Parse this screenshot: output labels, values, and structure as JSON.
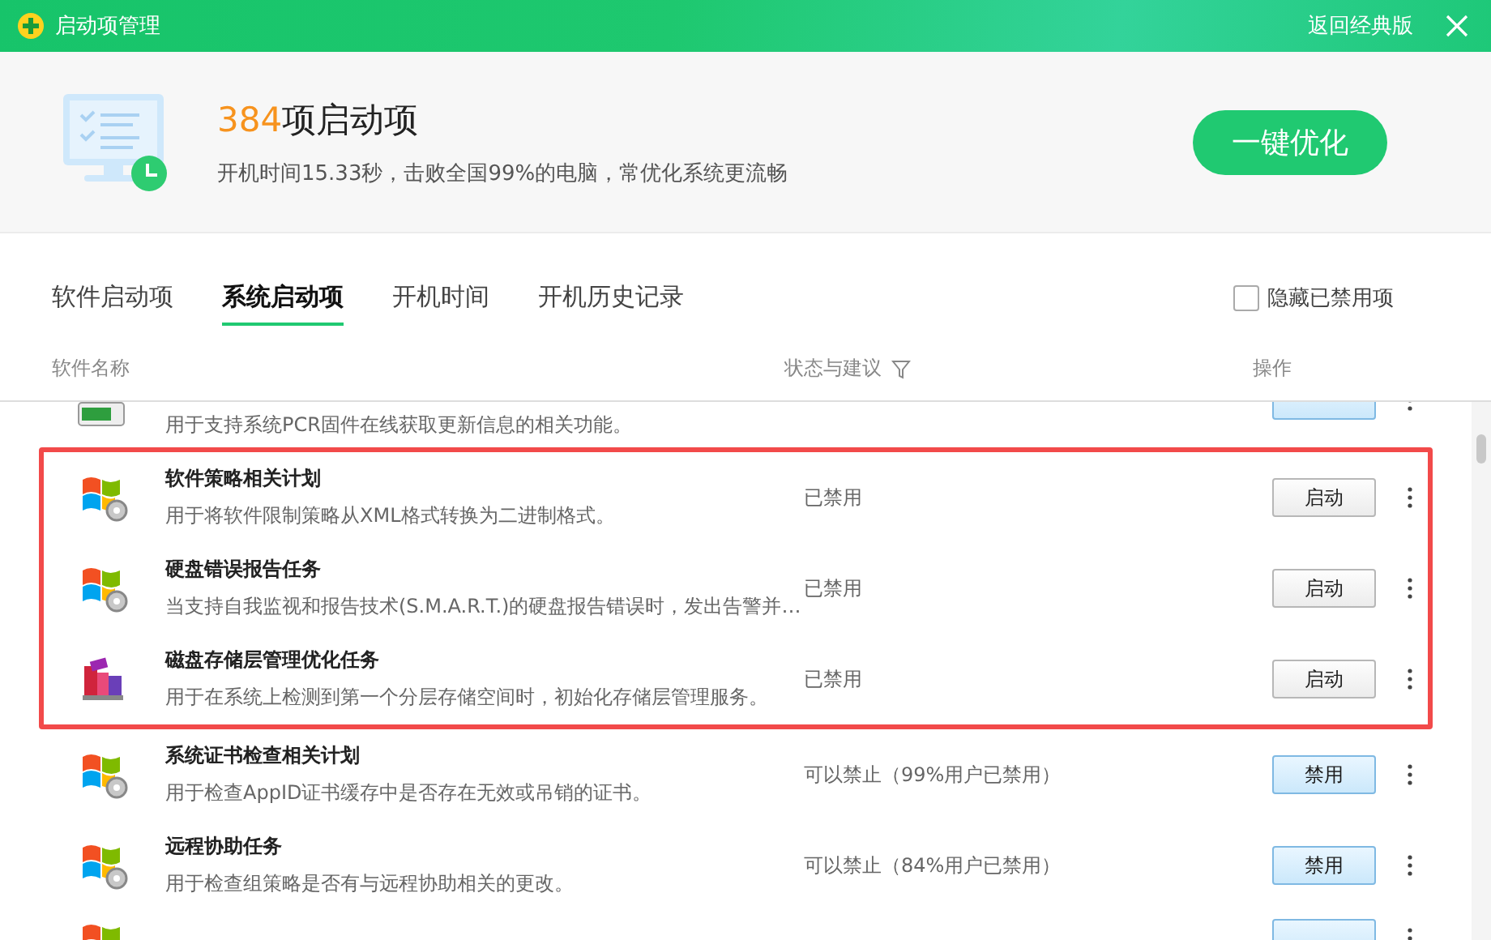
{
  "window": {
    "title": "启动项管理",
    "classic_link": "返回经典版"
  },
  "summary": {
    "count": "384",
    "count_suffix": "项启动项",
    "subtitle": "开机时间15.33秒，击败全国99%的电脑，常优化系统更流畅",
    "optimize_button": "一键优化"
  },
  "tabs": [
    {
      "label": "软件启动项",
      "selected": false
    },
    {
      "label": "系统启动项",
      "selected": true
    },
    {
      "label": "开机时间",
      "selected": false
    },
    {
      "label": "开机历史记录",
      "selected": false
    }
  ],
  "hide_disabled": {
    "label": "隐藏已禁用项",
    "checked": false
  },
  "table": {
    "columns": [
      "软件名称",
      "状态与建议",
      "操作"
    ],
    "sections": [
      {
        "highlighted": false,
        "rows": [
          {
            "kind": "battery",
            "description": "用于支持系统PCR固件在线获取更新信息的相关功能。",
            "disabled": false
          }
        ]
      },
      {
        "highlighted": true,
        "rows": [
          {
            "kind": "windows",
            "name": "软件策略相关计划",
            "description": "用于将软件限制策略从XML格式转换为二进制格式。",
            "status": "已禁用",
            "button": "启动",
            "disabled": true
          },
          {
            "kind": "windows",
            "name": "硬盘错误报告任务",
            "description": "当支持自我监视和报告技术(S.M.A.R.T.)的硬盘报告错误时，发出告警并…",
            "status": "已禁用",
            "button": "启动",
            "disabled": true
          },
          {
            "kind": "disk",
            "name": "磁盘存储层管理优化任务",
            "description": "用于在系统上检测到第一个分层存储空间时，初始化存储层管理服务。",
            "status": "已禁用",
            "button": "启动",
            "disabled": true
          }
        ]
      },
      {
        "highlighted": false,
        "rows": [
          {
            "kind": "windows",
            "name": "系统证书检查相关计划",
            "description": "用于检查AppID证书缓存中是否存在无效或吊销的证书。",
            "status": "可以禁止（99%用户已禁用）",
            "button": "禁用",
            "disabled": false
          },
          {
            "kind": "windows",
            "name": "远程协助任务",
            "description": "用于检查组策略是否有与远程协助相关的更改。",
            "status": "可以禁止（84%用户已禁用）",
            "button": "禁用",
            "disabled": false
          },
          {
            "kind": "windows",
            "disabled": false
          }
        ]
      }
    ]
  }
}
